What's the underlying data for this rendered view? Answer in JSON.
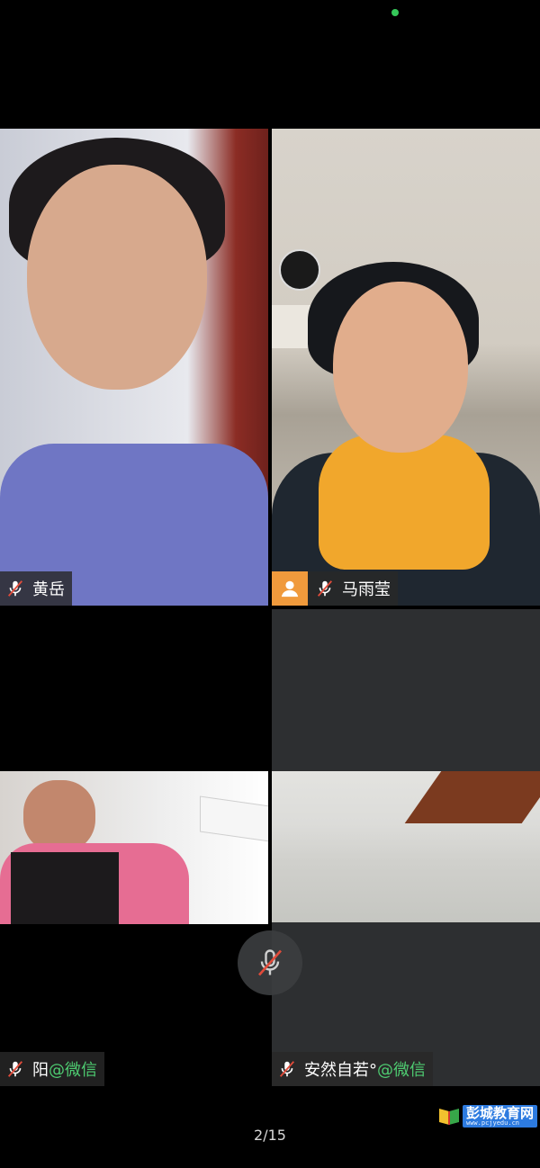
{
  "participants": [
    {
      "name": "黄岳",
      "suffix": "",
      "muted": true,
      "has_avatar_icon": false
    },
    {
      "name": "马雨莹",
      "suffix": "",
      "muted": true,
      "has_avatar_icon": true
    },
    {
      "name": "阳",
      "suffix": "@微信",
      "muted": true,
      "has_avatar_icon": false
    },
    {
      "name": "安然自若°",
      "suffix": "@微信",
      "muted": true,
      "has_avatar_icon": false
    }
  ],
  "controls": {
    "mic_icon": "mic-off-icon"
  },
  "pagination": {
    "current_total": "2/15"
  },
  "watermark": {
    "title": "彭城教育网",
    "url": "www.pcjyedu.cn"
  },
  "colors": {
    "accent_green": "#4ecb71",
    "avatar_orange": "#f09a3c",
    "status_dot": "#35c759"
  }
}
